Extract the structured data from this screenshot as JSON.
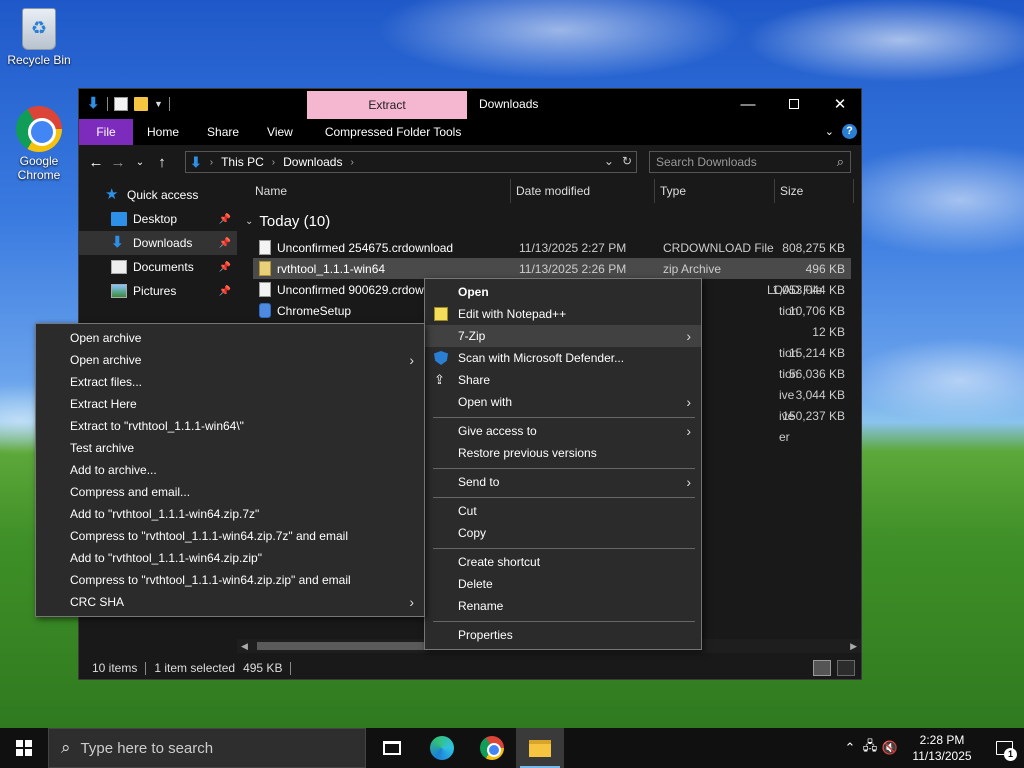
{
  "desktop": {
    "icons": [
      {
        "label": "Recycle Bin",
        "icon": "recycle-bin-icon"
      },
      {
        "label": "Google Chrome",
        "icon": "chrome-icon"
      }
    ]
  },
  "window": {
    "title": "Downloads",
    "context_tab": "Extract",
    "context_tab_color": "#f5b7d0",
    "ribbon_tabs": [
      "File",
      "Home",
      "Share",
      "View",
      "Compressed Folder Tools"
    ],
    "file_tab_color": "#7d2bbd",
    "address": {
      "crumbs": [
        "This PC",
        "Downloads"
      ]
    },
    "search_placeholder": "Search Downloads",
    "nav_pane": [
      {
        "label": "Quick access",
        "icon": "star-icon"
      },
      {
        "label": "Desktop",
        "icon": "desktop-icon",
        "pinned": true
      },
      {
        "label": "Downloads",
        "icon": "downloads-icon",
        "pinned": true
      },
      {
        "label": "Documents",
        "icon": "documents-icon",
        "pinned": true
      },
      {
        "label": "Pictures",
        "icon": "pictures-icon",
        "pinned": true
      }
    ],
    "columns": [
      "Name",
      "Date modified",
      "Type",
      "Size"
    ],
    "group": "Today (10)",
    "files": [
      {
        "name": "Unconfirmed 254675.crdownload",
        "date": "11/13/2025 2:27 PM",
        "type": "CRDOWNLOAD File",
        "size": "808,275 KB",
        "icon": "file-icon"
      },
      {
        "name": "rvthtool_1.1.1-win64",
        "date": "11/13/2025 2:26 PM",
        "type": "zip Archive",
        "size": "496 KB",
        "icon": "zip-icon",
        "selected": true
      },
      {
        "name": "Unconfirmed 900629.crdown",
        "date": "",
        "type": "LOAD File",
        "size": "1,053,044 KB",
        "icon": "file-icon"
      },
      {
        "name": "ChromeSetup",
        "date": "",
        "type": "tion",
        "size": "10,706 KB",
        "icon": "setup-icon"
      },
      {
        "name": "",
        "date": "",
        "type": "",
        "size": "12 KB"
      },
      {
        "name": "",
        "date": "",
        "type": "tion",
        "size": "15,214 KB"
      },
      {
        "name": "",
        "date": "",
        "type": "tion",
        "size": "56,036 KB"
      },
      {
        "name": "",
        "date": "",
        "type": "ive",
        "size": "3,044 KB"
      },
      {
        "name": "",
        "date": "",
        "type": "ive",
        "size": "150,237 KB"
      },
      {
        "name": "",
        "date": "",
        "type": "er",
        "size": ""
      }
    ],
    "status": {
      "items": "10 items",
      "selected": "1 item selected",
      "size": "495 KB"
    }
  },
  "context_menu": {
    "items": [
      {
        "label": "Open",
        "bold": true
      },
      {
        "label": "Edit with Notepad++",
        "icon": "notepadpp-icon"
      },
      {
        "label": "7-Zip",
        "submenu": true,
        "highlighted": true
      },
      {
        "label": "Scan with Microsoft Defender...",
        "icon": "defender-icon"
      },
      {
        "label": "Share",
        "icon": "share-icon"
      },
      {
        "label": "Open with",
        "submenu": true
      },
      {
        "divider": true
      },
      {
        "label": "Give access to",
        "submenu": true
      },
      {
        "label": "Restore previous versions"
      },
      {
        "divider": true
      },
      {
        "label": "Send to",
        "submenu": true
      },
      {
        "divider": true
      },
      {
        "label": "Cut"
      },
      {
        "label": "Copy"
      },
      {
        "divider": true
      },
      {
        "label": "Create shortcut"
      },
      {
        "label": "Delete"
      },
      {
        "label": "Rename"
      },
      {
        "divider": true
      },
      {
        "label": "Properties"
      }
    ]
  },
  "sevenzip_menu": {
    "items": [
      {
        "label": "Open archive"
      },
      {
        "label": "Open archive",
        "submenu": true
      },
      {
        "label": "Extract files..."
      },
      {
        "label": "Extract Here"
      },
      {
        "label": "Extract to \"rvthtool_1.1.1-win64\\\""
      },
      {
        "label": "Test archive"
      },
      {
        "label": "Add to archive..."
      },
      {
        "label": "Compress and email..."
      },
      {
        "label": "Add to \"rvthtool_1.1.1-win64.zip.7z\""
      },
      {
        "label": "Compress to \"rvthtool_1.1.1-win64.zip.7z\" and email"
      },
      {
        "label": "Add to \"rvthtool_1.1.1-win64.zip.zip\""
      },
      {
        "label": "Compress to \"rvthtool_1.1.1-win64.zip.zip\" and email"
      },
      {
        "label": "CRC SHA",
        "submenu": true
      }
    ]
  },
  "taskbar": {
    "search_placeholder": "Type here to search",
    "pinned": [
      "task-view-icon",
      "edge-icon",
      "chrome-icon",
      "file-explorer-icon"
    ],
    "active": "file-explorer-icon",
    "time": "2:28 PM",
    "date": "11/13/2025",
    "notification_count": "1"
  }
}
